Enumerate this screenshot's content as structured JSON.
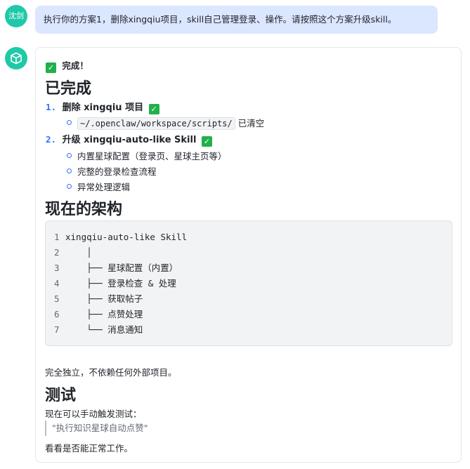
{
  "user": {
    "avatar_text": "沈剑",
    "message": "执行你的方案1，删除xingqiu项目，skill自己管理登录、操作。请按照这个方案升级skill。"
  },
  "bot": {
    "avatar_icon": "cube-icon",
    "done_text": "完成！",
    "section1_title": "已完成",
    "items": [
      {
        "num": "1.",
        "label": "删除 xingqiu 项目",
        "subs": [
          {
            "code": "~/.openclaw/workspace/scripts/",
            "text": "已清空"
          }
        ]
      },
      {
        "num": "2.",
        "label": "升级 xingqiu-auto-like Skill",
        "subs": [
          {
            "text": "内置星球配置（登录页、星球主页等）"
          },
          {
            "text": "完整的登录检查流程"
          },
          {
            "text": "异常处理逻辑"
          }
        ]
      }
    ],
    "section2_title": "现在的架构",
    "code_lines": [
      {
        "ln": "1",
        "text": "xingqiu-auto-like Skill"
      },
      {
        "ln": "2",
        "text": "    │"
      },
      {
        "ln": "3",
        "text": "    ├── 星球配置（内置）"
      },
      {
        "ln": "4",
        "text": "    ├── 登录检查 & 处理"
      },
      {
        "ln": "5",
        "text": "    ├── 获取帖子"
      },
      {
        "ln": "6",
        "text": "    ├── 点赞处理"
      },
      {
        "ln": "7",
        "text": "    └── 消息通知"
      }
    ],
    "independent_text": "完全独立，不依赖任何外部项目。",
    "section3_title": "测试",
    "test_intro": "现在可以手动触发测试：",
    "quote": "\"执行知识星球自动点赞\"",
    "closing": "看看是否能正常工作。",
    "check_mark": "✓",
    "colors": {
      "accent_teal": "#1fc9a8",
      "user_bubble": "#dbe6ff",
      "check_green": "#21b04b",
      "number_blue": "#3370ff"
    }
  }
}
